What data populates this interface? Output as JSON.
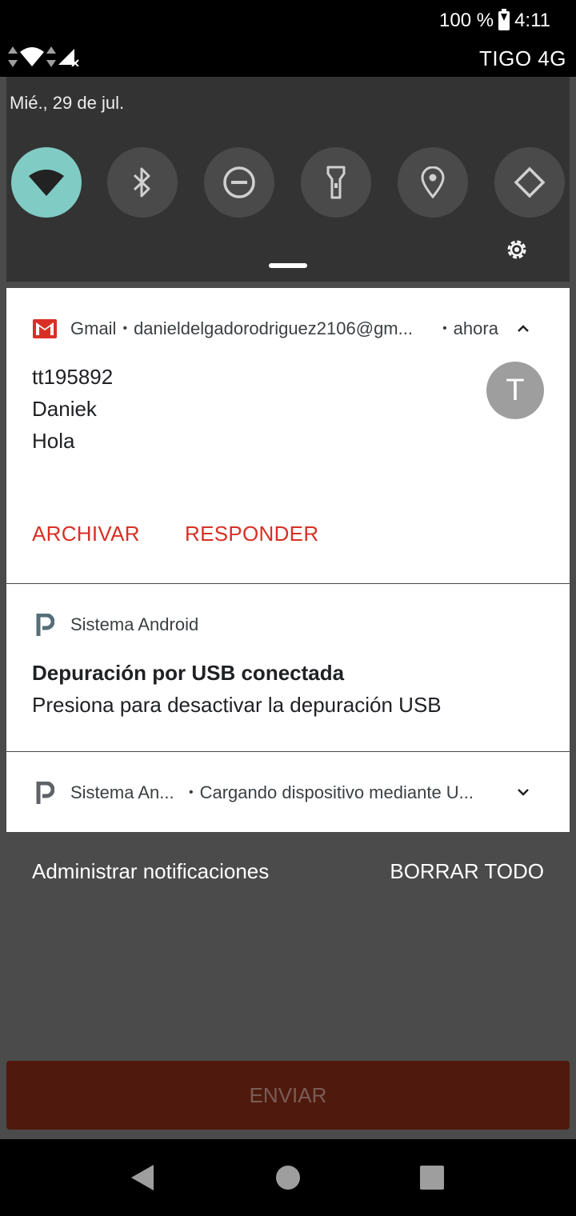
{
  "status_bar": {
    "battery": "100 %",
    "time": "4:11",
    "carrier": "TIGO 4G"
  },
  "quick_settings": {
    "date": "Mié., 29 de jul.",
    "tiles": [
      {
        "icon": "wifi-icon",
        "active": true
      },
      {
        "icon": "bluetooth-icon",
        "active": false
      },
      {
        "icon": "do-not-disturb-icon",
        "active": false
      },
      {
        "icon": "flashlight-icon",
        "active": false
      },
      {
        "icon": "location-icon",
        "active": false
      },
      {
        "icon": "auto-rotate-icon",
        "active": false
      }
    ]
  },
  "notifications": {
    "gmail": {
      "app": "Gmail",
      "account": "danieldelgadorodriguez2106@gm...",
      "time": "ahora",
      "title": "tt195892",
      "lines": [
        "Daniek",
        "Hola"
      ],
      "avatar": "T",
      "actions": [
        "ARCHIVAR",
        "RESPONDER"
      ]
    },
    "usb": {
      "app": "Sistema Android",
      "title": "Depuración por USB conectada",
      "text": "Presiona para desactivar la depuración USB"
    },
    "charging": {
      "app": "Sistema An...",
      "text": "Cargando dispositivo mediante U..."
    }
  },
  "footer": {
    "manage": "Administrar notificaciones",
    "clear_all": "BORRAR TODO"
  },
  "background_app": {
    "button": "ENVIAR"
  },
  "colors": {
    "accent_active_tile": "#80cbc4",
    "gmail_red": "#d93025",
    "shade_background": "#4b4b4b"
  }
}
